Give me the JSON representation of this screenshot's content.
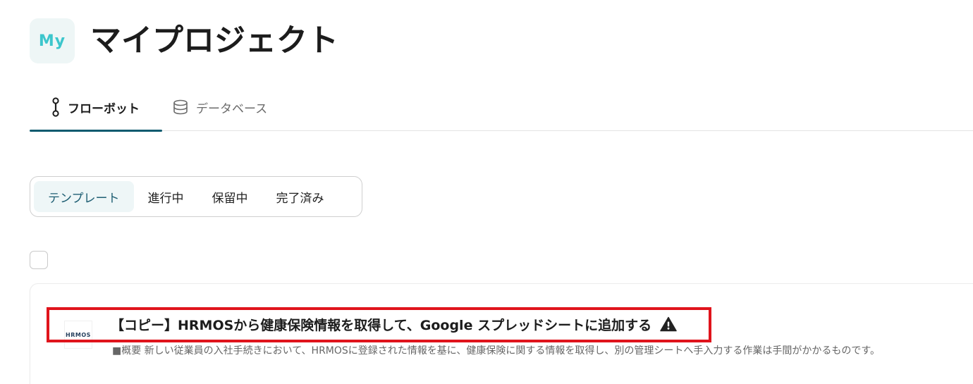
{
  "header": {
    "avatar_text": "My",
    "title": "マイプロジェクト"
  },
  "tabs": [
    {
      "label": "フローボット",
      "icon": "flowbot-icon",
      "active": true
    },
    {
      "label": "データベース",
      "icon": "database-icon",
      "active": false
    }
  ],
  "filters": [
    {
      "label": "テンプレート",
      "active": true
    },
    {
      "label": "進行中",
      "active": false
    },
    {
      "label": "保留中",
      "active": false
    },
    {
      "label": "完了済み",
      "active": false
    }
  ],
  "flow": {
    "app_logo_text": "HRMOS",
    "title": "【コピー】HRMOSから健康保険情報を取得して、Google スプレッドシートに追加する",
    "warning_icon": "warning-icon",
    "description": "■概要 新しい従業員の入社手続きにおいて、HRMOSに登録された情報を基に、健康保険に関する情報を取得し、別の管理シートへ手入力する作業は手間がかかるものです。"
  },
  "colors": {
    "accent": "#0d5a6f",
    "avatar_text": "#3cc6cc",
    "highlight": "#e0141c"
  }
}
